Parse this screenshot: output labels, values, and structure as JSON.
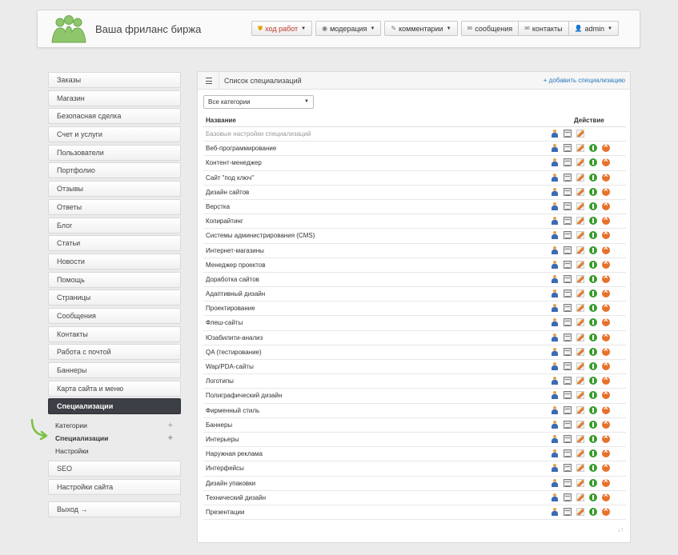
{
  "header": {
    "site_title": "Ваша фриланс биржа",
    "nav": [
      {
        "label": "ход работ",
        "icon": "shield-icon",
        "dropdown": true,
        "highlight": true
      },
      {
        "label": "модерация",
        "icon": "eye-icon",
        "dropdown": true
      },
      {
        "label": "комментарии",
        "icon": "pencil-icon",
        "dropdown": true
      },
      {
        "label": "сообщения",
        "icon": "envelope-icon",
        "dropdown": false
      },
      {
        "label": "контакты",
        "icon": "envelope-icon",
        "dropdown": false
      },
      {
        "label": "admin",
        "icon": "user-icon",
        "dropdown": true
      }
    ]
  },
  "sidebar": {
    "items": [
      "Заказы",
      "Магазин",
      "Безопасная сделка",
      "Счет и услуги",
      "Пользователи",
      "Портфолио",
      "Отзывы",
      "Ответы",
      "Блог",
      "Статьи",
      "Новости",
      "Помощь",
      "Страницы",
      "Сообщения",
      "Контакты",
      "Работа с почтой",
      "Баннеры",
      "Карта сайта и меню"
    ],
    "active": "Специализации",
    "subitems": [
      {
        "label": "Категории",
        "bold": false,
        "plus": true
      },
      {
        "label": "Специализации",
        "bold": true,
        "plus": true
      },
      {
        "label": "Настройки",
        "bold": false,
        "plus": false
      }
    ],
    "after_items": [
      "SEO",
      "Настройки сайта"
    ],
    "logout": "Выход →"
  },
  "main": {
    "title": "Список специализаций",
    "add_link": "+ добавить специализацию",
    "filter": {
      "selected": "Все категории"
    },
    "columns": {
      "name": "Название",
      "action": "Действие"
    },
    "rows": [
      {
        "name": "Базовые настройки специализаций",
        "muted": true
      },
      {
        "name": "Веб-программирование"
      },
      {
        "name": "Контент-менеджер"
      },
      {
        "name": "Сайт \"под ключ\""
      },
      {
        "name": "Дизайн сайтов"
      },
      {
        "name": "Верстка"
      },
      {
        "name": "Копирайтинг"
      },
      {
        "name": "Системы администрирования (CMS)"
      },
      {
        "name": "Интернет-магазины"
      },
      {
        "name": "Менеджер проектов"
      },
      {
        "name": "Доработка сайтов"
      },
      {
        "name": "Адаптивный дизайн"
      },
      {
        "name": "Проектирование"
      },
      {
        "name": "Флеш-сайты"
      },
      {
        "name": "Юзабилити-анализ"
      },
      {
        "name": "QA (тестирование)"
      },
      {
        "name": "Wap/PDA-сайты"
      },
      {
        "name": "Логотипы"
      },
      {
        "name": "Полиграфический дизайн"
      },
      {
        "name": "Фирменный стиль"
      },
      {
        "name": "Баннеры"
      },
      {
        "name": "Интерьеры"
      },
      {
        "name": "Наружная реклама"
      },
      {
        "name": "Интерфейсы"
      },
      {
        "name": "Дизайн упаковки"
      },
      {
        "name": "Технический дизайн"
      },
      {
        "name": "Презентации"
      }
    ],
    "sort_icon": "↓↑"
  }
}
